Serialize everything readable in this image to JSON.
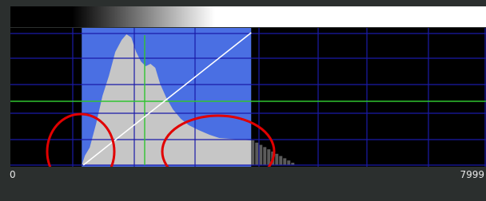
{
  "histogram": {
    "axis": {
      "min_label": "0",
      "max_label": "7999"
    },
    "colors": {
      "background": "#2b2f2e",
      "plot_background": "#000000",
      "grid_lines": "#1a1aa8",
      "green_guides": "#31c431",
      "window_highlight": "#4a6fe3",
      "histogram_fill": "#c6c6c6",
      "histogram_tail": "#5a5a5a",
      "transfer_curve": "#ffffff",
      "annotation_circles": "#e10000"
    },
    "window": {
      "min_value": 1200,
      "max_value": 4050
    },
    "transfer_curve": {
      "type": "linear"
    },
    "annotations": [
      {
        "name": "low-end-circle",
        "shape": "ellipse",
        "color": "#e10000"
      },
      {
        "name": "tail-circle",
        "shape": "ellipse",
        "color": "#e10000"
      }
    ]
  }
}
